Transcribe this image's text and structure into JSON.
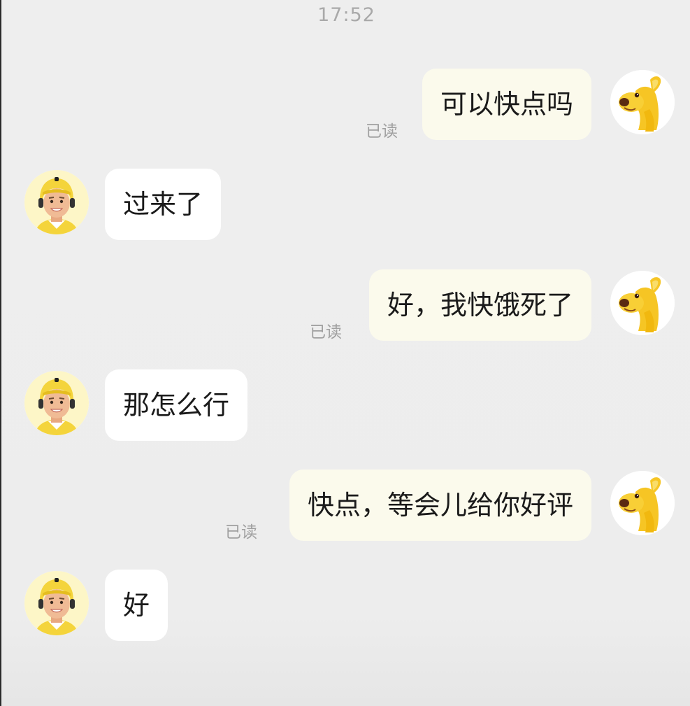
{
  "header": {
    "time": "17:52"
  },
  "read_label": "已读",
  "colors": {
    "background": "#ededed",
    "my_bubble": "#fbfaec",
    "rider_bubble": "#ffffff",
    "accent_yellow": "#f5c518"
  },
  "icons": {
    "my_avatar": "yellow-kangaroo-avatar-icon",
    "rider_avatar": "rider-helmet-avatar-icon"
  },
  "messages": [
    {
      "sender": "me",
      "text": "可以快点吗",
      "status": "已读"
    },
    {
      "sender": "rider",
      "text": "过来了"
    },
    {
      "sender": "me",
      "text": "好，我快饿死了",
      "status": "已读"
    },
    {
      "sender": "rider",
      "text": "那怎么行"
    },
    {
      "sender": "me",
      "text": "快点，等会儿给你好评",
      "status": "已读"
    },
    {
      "sender": "rider",
      "text": "好"
    }
  ]
}
